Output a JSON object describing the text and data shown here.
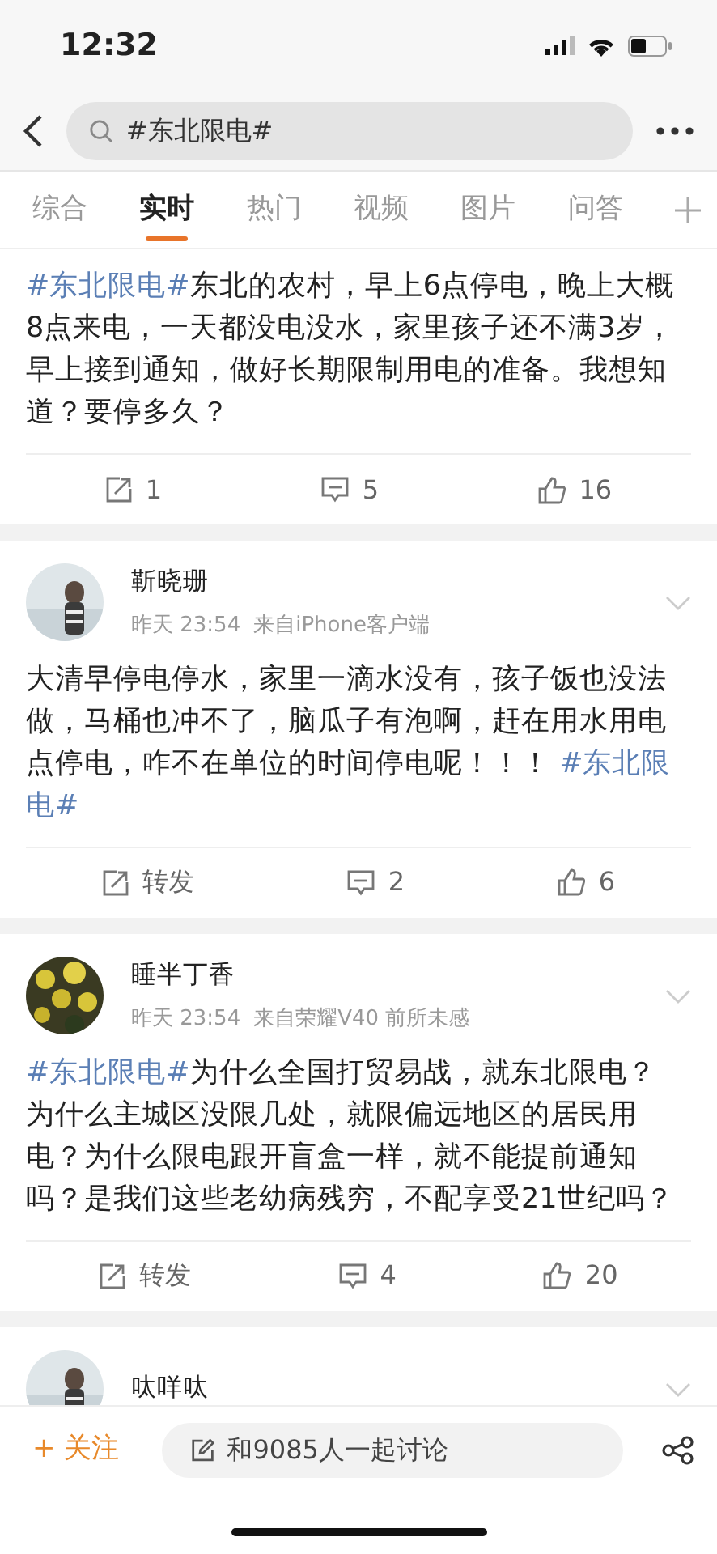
{
  "status_bar": {
    "time": "12:32"
  },
  "search": {
    "value": "#东北限电#"
  },
  "tabs": [
    {
      "label": "综合",
      "selected": false
    },
    {
      "label": "实时",
      "selected": true
    },
    {
      "label": "热门",
      "selected": false
    },
    {
      "label": "视频",
      "selected": false
    },
    {
      "label": "图片",
      "selected": false
    },
    {
      "label": "问答",
      "selected": false
    }
  ],
  "posts": [
    {
      "segments": [
        {
          "kind": "hashtag",
          "text": "#东北限电#"
        },
        {
          "kind": "plain",
          "text": "东北的农村，早上6点停电，晚上大概8点来电，一天都没电没水，家里孩子还不满3岁，早上接到通知，做好长期限制用电的准备。我想知道？要停多久？"
        }
      ],
      "repost": "1",
      "comments": "5",
      "likes": "16"
    },
    {
      "author": "靳晓珊",
      "time": "昨天 23:54",
      "source": "来自iPhone客户端",
      "segments": [
        {
          "kind": "plain",
          "text": "大清早停电停水，家里一滴水没有，孩子饭也没法做，马桶也冲不了，脑瓜子有泡啊，赶在用水用电点停电，咋不在单位的时间停电呢！！！ "
        },
        {
          "kind": "hashtag",
          "text": "#东北限电#"
        }
      ],
      "repost": "转发",
      "comments": "2",
      "likes": "6"
    },
    {
      "author": "睡半丁香",
      "time": "昨天 23:54",
      "source": "来自荣耀V40 前所未感",
      "segments": [
        {
          "kind": "hashtag",
          "text": "#东北限电#"
        },
        {
          "kind": "plain",
          "text": "为什么全国打贸易战，就东北限电？为什么主城区没限几处，就限偏远地区的居民用电？为什么限电跟开盲盒一样，就不能提前通知吗？是我们这些老幼病残穷，不配享受21世纪吗？"
        }
      ],
      "repost": "转发",
      "comments": "4",
      "likes": "20"
    },
    {
      "author": "呔咩呔"
    }
  ],
  "bottom_bar": {
    "follow": "+ 关注",
    "comment_placeholder": "和9085人一起讨论"
  }
}
